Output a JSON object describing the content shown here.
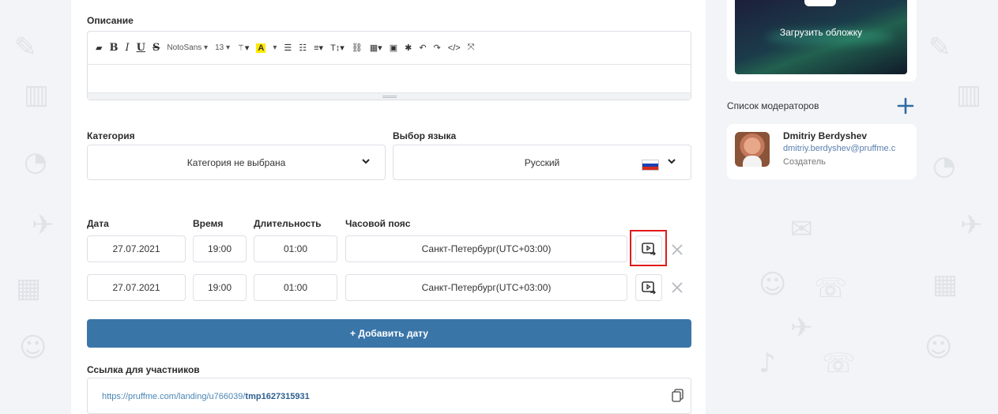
{
  "description": {
    "label": "Описание",
    "toolbar": {
      "font_family": "NotoSans ▾",
      "font_size": "13 ▾",
      "highlight_label": "A"
    }
  },
  "category": {
    "label": "Категория",
    "value": "Категория не выбрана"
  },
  "language": {
    "label": "Выбор языка",
    "value": "Русский"
  },
  "schedule": {
    "headers": {
      "date": "Дата",
      "time": "Время",
      "duration": "Длительность",
      "timezone": "Часовой пояс"
    },
    "rows": [
      {
        "date": "27.07.2021",
        "time": "19:00",
        "duration": "01:00",
        "timezone": "Санкт-Петербург(UTC+03:00)"
      },
      {
        "date": "27.07.2021",
        "time": "19:00",
        "duration": "01:00",
        "timezone": "Санкт-Петербург(UTC+03:00)"
      }
    ],
    "add_button": "+ Добавить дату"
  },
  "participants_link": {
    "label": "Ссылка для участников",
    "base": "https://pruffme.com/landing/u766039/",
    "slug": "tmp1627315931"
  },
  "cover": {
    "upload_label": "Загрузить обложку"
  },
  "moderators": {
    "header": "Список модераторов",
    "items": [
      {
        "name": "Dmitriy Berdyshev",
        "email": "dmitriy.berdyshev@pruffme.c",
        "role": "Создатель"
      }
    ]
  },
  "colors": {
    "primary": "#3a75a8",
    "highlight_border": "#e01b1b",
    "link": "#4a86b5"
  }
}
